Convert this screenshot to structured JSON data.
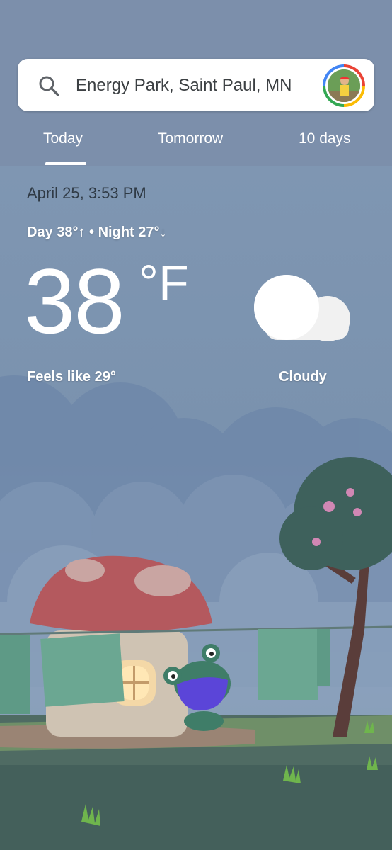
{
  "search": {
    "location": "Energy Park, Saint Paul, MN"
  },
  "tabs": [
    {
      "label": "Today",
      "selected": true
    },
    {
      "label": "Tomorrow",
      "selected": false
    },
    {
      "label": "10 days",
      "selected": false
    }
  ],
  "weather": {
    "datetime": "April 25, 3:53 PM",
    "day_night": "Day 38°↑ • Night 27°↓",
    "temperature": "38",
    "unit": "°F",
    "feels_like": "Feels like 29°",
    "condition": "Cloudy",
    "condition_icon": "cloud-icon"
  },
  "colors": {
    "accent": "#ffffff",
    "header_bg": "#7c8fab"
  }
}
